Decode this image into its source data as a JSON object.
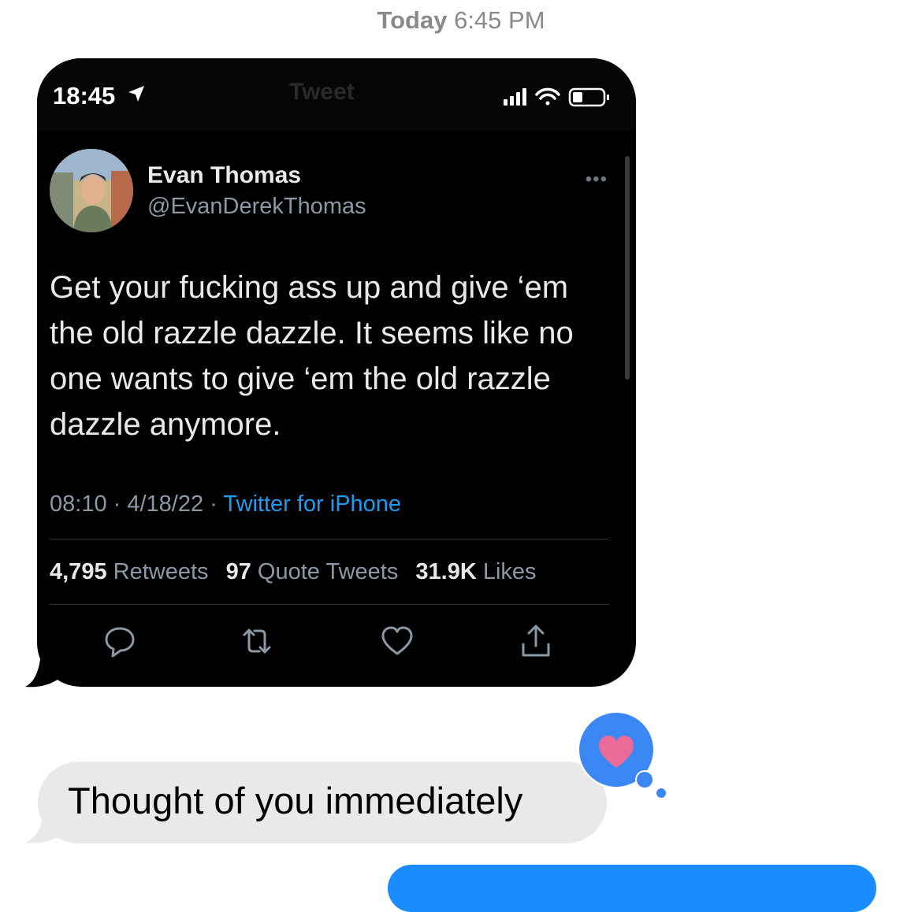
{
  "thread": {
    "timestamp_day": "Today",
    "timestamp_time": "6:45 PM"
  },
  "screenshot": {
    "status_time": "18:45",
    "header_title": "Tweet",
    "author_name": "Evan Thomas",
    "author_handle": "@EvanDerekThomas",
    "more_label": "•••",
    "text": "Get your fucking ass up and give ‘em the old razzle dazzle. It seems like no one wants to give ‘em the old razzle dazzle anymore.",
    "time": "08:10",
    "date": "4/18/22",
    "source": "Twitter for iPhone",
    "retweets_count": "4,795",
    "retweets_label": "Retweets",
    "quotes_count": "97",
    "quotes_label": "Quote Tweets",
    "likes_count": "31.9K",
    "likes_label": "Likes",
    "icons": [
      "reply-icon",
      "retweet-icon",
      "like-icon",
      "share-icon"
    ],
    "source_color": "#1d9bf0"
  },
  "message": {
    "text": "Thought of you immediately",
    "tapback": "heart",
    "tapback_color": "#ea6a98"
  }
}
